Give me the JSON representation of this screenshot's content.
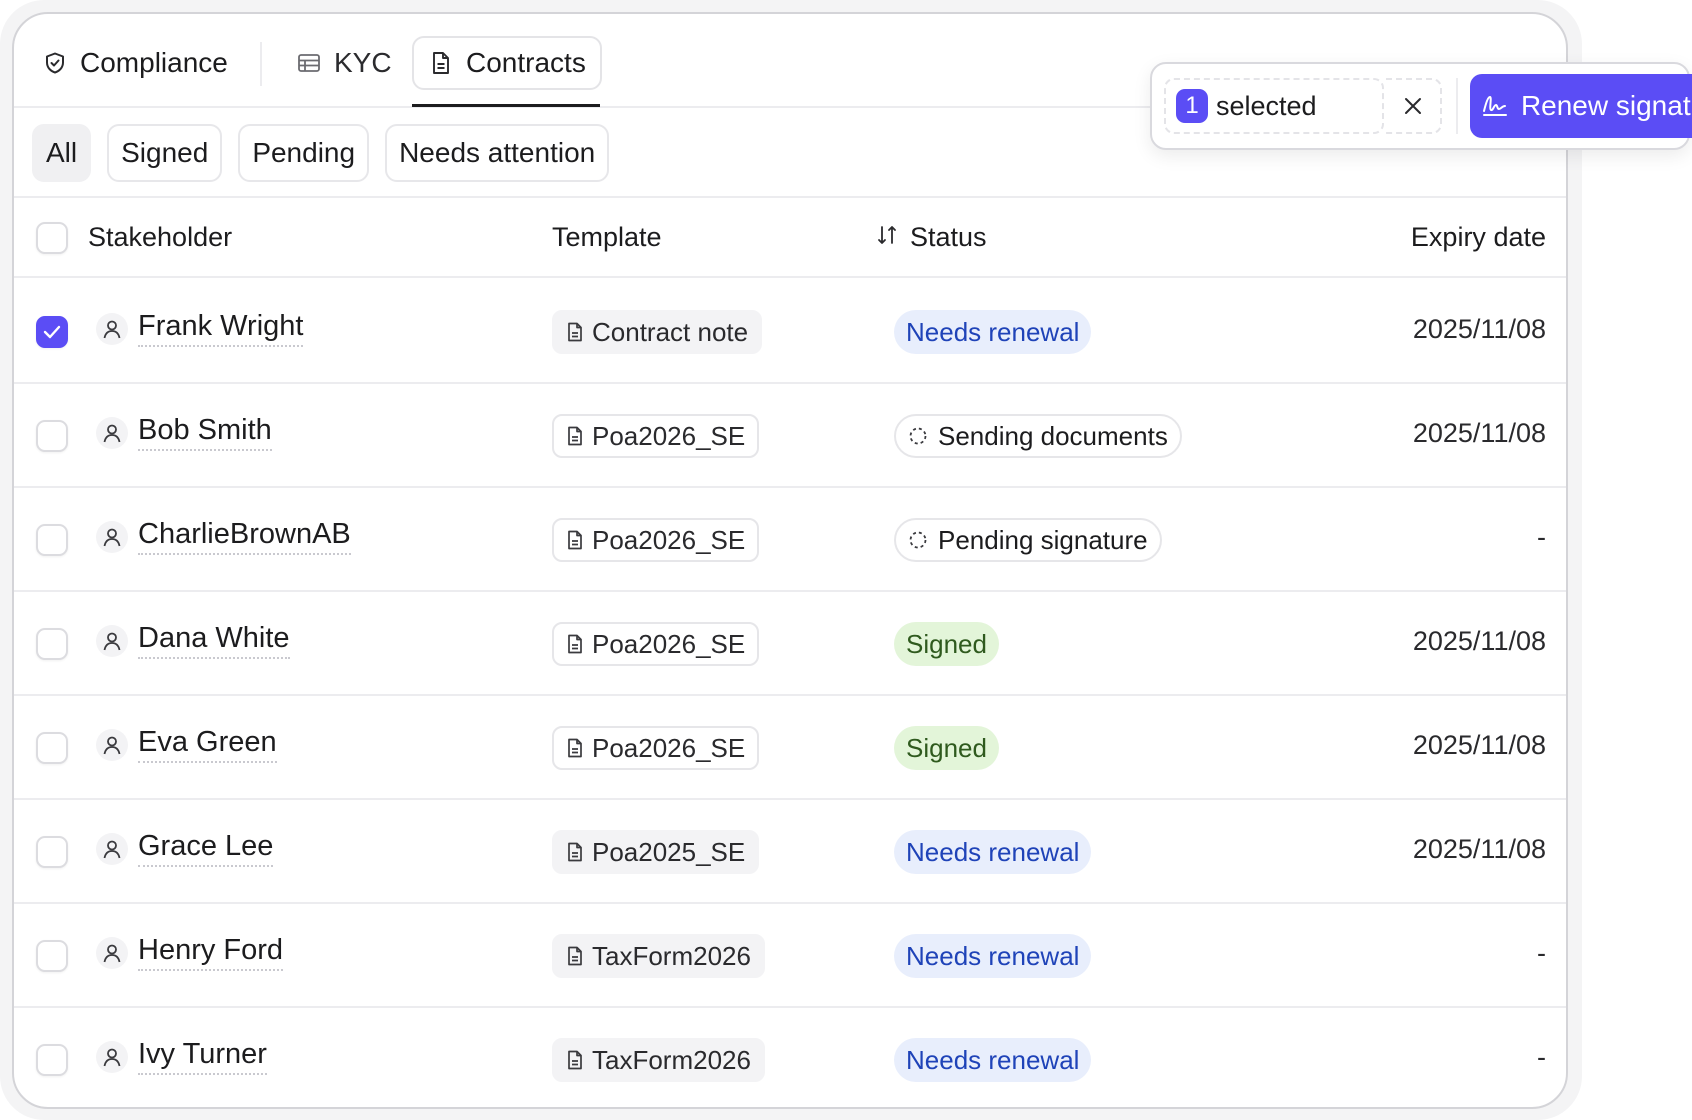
{
  "tabs": {
    "compliance": "Compliance",
    "kyc": "KYC",
    "contracts": "Contracts"
  },
  "filters": [
    "All",
    "Signed",
    "Pending",
    "Needs attention"
  ],
  "table": {
    "headers": {
      "stakeholder": "Stakeholder",
      "template": "Template",
      "status": "Status",
      "expiry": "Expiry date"
    },
    "rows": [
      {
        "name": "Frank Wright",
        "template": "Contract note",
        "status": "Needs renewal",
        "status_kind": "renew",
        "expiry": "2025/11/08",
        "checked": true
      },
      {
        "name": "Bob Smith",
        "template": "Poa2026_SE",
        "status": "Sending documents",
        "status_kind": "pending",
        "expiry": "2025/11/08",
        "checked": false
      },
      {
        "name": "CharlieBrownAB",
        "template": "Poa2026_SE",
        "status": "Pending signature",
        "status_kind": "pending",
        "expiry": "-",
        "checked": false
      },
      {
        "name": "Dana White",
        "template": "Poa2026_SE",
        "status": "Signed",
        "status_kind": "signed",
        "expiry": "2025/11/08",
        "checked": false
      },
      {
        "name": "Eva Green",
        "template": "Poa2026_SE",
        "status": "Signed",
        "status_kind": "signed",
        "expiry": "2025/11/08",
        "checked": false
      },
      {
        "name": "Grace Lee",
        "template": "Poa2025_SE",
        "status": "Needs renewal",
        "status_kind": "renew",
        "expiry": "2025/11/08",
        "checked": false
      },
      {
        "name": "Henry Ford",
        "template": "TaxForm2026",
        "status": "Needs renewal",
        "status_kind": "renew",
        "expiry": "-",
        "checked": false
      },
      {
        "name": "Ivy Turner",
        "template": "TaxForm2026",
        "status": "Needs renewal",
        "status_kind": "renew",
        "expiry": "-",
        "checked": false
      }
    ]
  },
  "selection": {
    "count": "1",
    "label": "selected",
    "action": "Renew signature"
  },
  "colors": {
    "accent": "#5b4df5",
    "renew_bg": "#e8eefc",
    "renew_text": "#1f43b8",
    "signed_bg": "#e3f5d9",
    "signed_text": "#2f5a1e"
  }
}
